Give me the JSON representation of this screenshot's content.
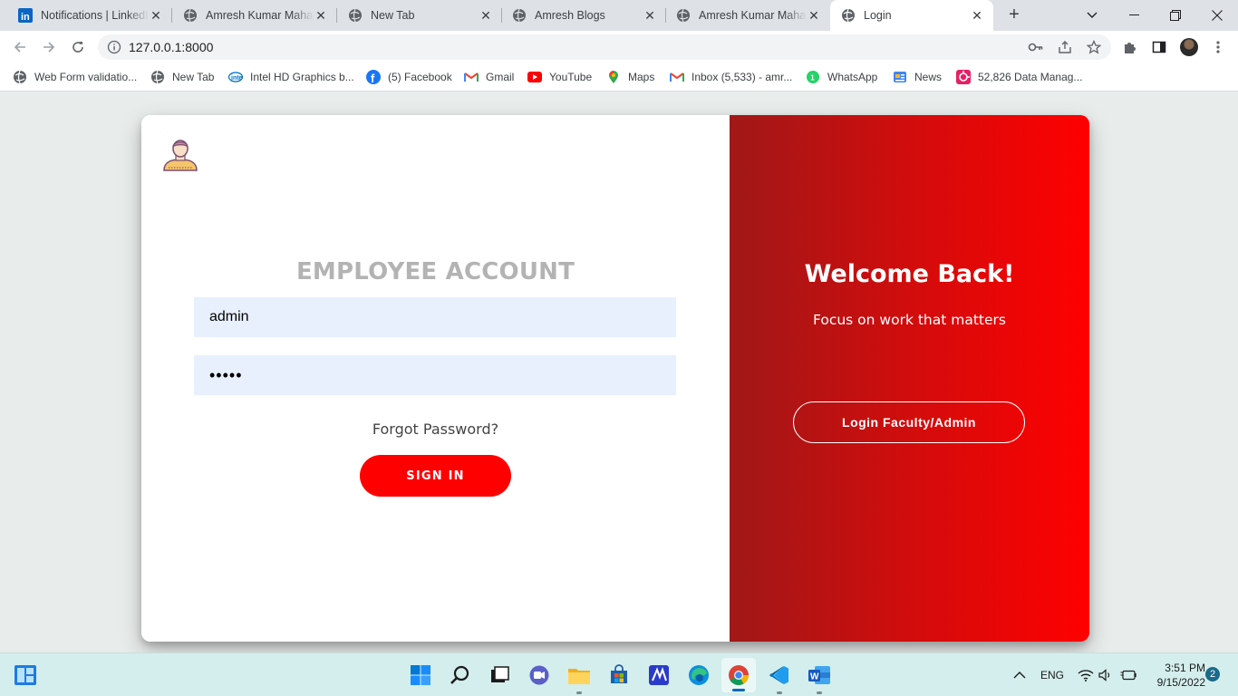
{
  "browser": {
    "tabs": [
      {
        "title": "Notifications | LinkedIn",
        "icon": "linkedin-icon",
        "active": false
      },
      {
        "title": "Amresh Kumar Mahato",
        "icon": "globe-icon",
        "active": false
      },
      {
        "title": "New Tab",
        "icon": "globe-icon",
        "active": false
      },
      {
        "title": "Amresh Blogs",
        "icon": "globe-icon",
        "active": false
      },
      {
        "title": "Amresh Kumar Mahato",
        "icon": "globe-icon",
        "active": false
      },
      {
        "title": "Login",
        "icon": "globe-icon",
        "active": true
      }
    ],
    "address": "127.0.0.1:8000",
    "bookmarks": [
      {
        "label": "Web Form validatio...",
        "icon": "globe-icon"
      },
      {
        "label": "New Tab",
        "icon": "globe-icon"
      },
      {
        "label": "Intel HD Graphics b...",
        "icon": "intel-icon"
      },
      {
        "label": "(5) Facebook",
        "icon": "facebook-icon"
      },
      {
        "label": "Gmail",
        "icon": "gmail-icon"
      },
      {
        "label": "YouTube",
        "icon": "youtube-icon"
      },
      {
        "label": "Maps",
        "icon": "maps-icon"
      },
      {
        "label": "Inbox (5,533) - amr...",
        "icon": "gmail-icon"
      },
      {
        "label": "WhatsApp",
        "icon": "whatsapp-icon"
      },
      {
        "label": "News",
        "icon": "news-icon"
      },
      {
        "label": "52,826 Data Manag...",
        "icon": "data-icon"
      }
    ]
  },
  "login": {
    "title": "EMPLOYEE ACCOUNT",
    "username_value": "admin",
    "password_value": "•••••",
    "forgot_label": "Forgot Password?",
    "signin_label": "SIGN IN"
  },
  "welcome": {
    "title": "Welcome Back!",
    "subtitle": "Focus on work that matters",
    "admin_button_label": "Login Faculty/Admin"
  },
  "colors": {
    "accent": "#ff0000",
    "panel_gradient_start": "#a01818",
    "panel_gradient_end": "#ff0000",
    "input_bg": "#e8f0fe",
    "title_gray": "#b3b3b3"
  },
  "taskbar": {
    "language": "ENG",
    "time": "3:51 PM",
    "date": "9/15/2022",
    "notification_count": "2"
  }
}
